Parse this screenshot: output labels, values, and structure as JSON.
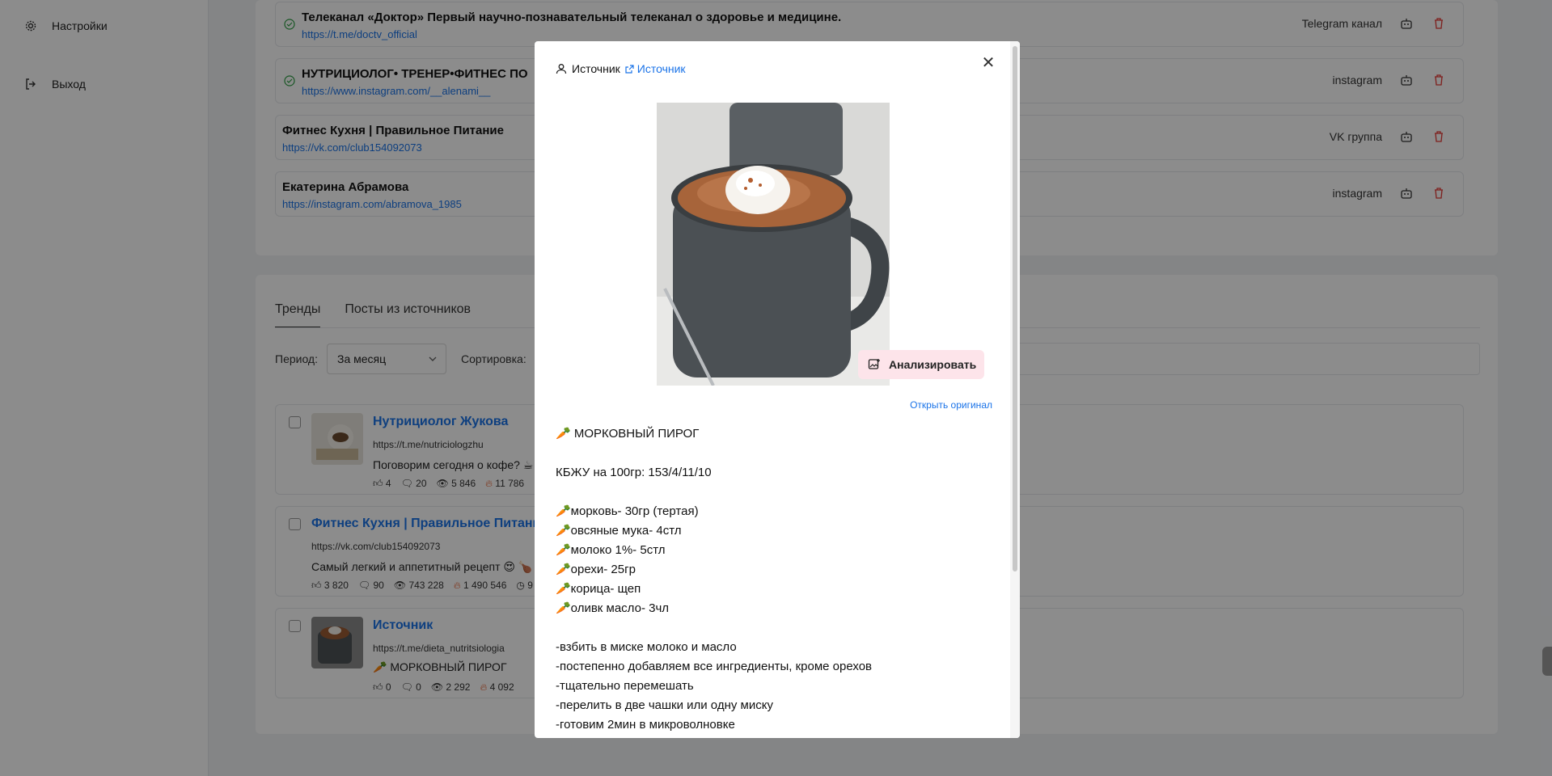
{
  "sidebar": {
    "items": [
      {
        "label": "Настройки",
        "icon": "gear-icon"
      },
      {
        "label": "Выход",
        "icon": "logout-icon"
      }
    ]
  },
  "sources": [
    {
      "title": "Телеканал «Доктор» Первый научно-познавательный телеканал о здоровье и медицине.",
      "url": "https://t.me/doctv_official",
      "type": "Telegram канал",
      "checked": true
    },
    {
      "title": "НУТРИЦИОЛОГ• ТРЕНЕР•ФИТНЕС ПО",
      "url": "https://www.instagram.com/__alenami__",
      "type": "instagram",
      "checked": true
    },
    {
      "title": "Фитнес Кухня | Правильное Питание",
      "url": "https://vk.com/club154092073",
      "type": "VK группа",
      "checked": false
    },
    {
      "title": "Екатерина Абрамова",
      "url": "https://instagram.com/abramova_1985",
      "type": "instagram",
      "checked": false
    }
  ],
  "tabs": [
    {
      "label": "Тренды",
      "active": true
    },
    {
      "label": "Посты из источников",
      "active": false
    }
  ],
  "filters": {
    "period_label": "Период:",
    "period_value": "За месяц",
    "sort_label": "Сортировка:"
  },
  "posts": [
    {
      "title": "Нутрициолог Жукова",
      "url": "https://t.me/nutriciologzhu",
      "text": "Поговорим сегодня о кофе? ☕",
      "likes": "4",
      "comments": "20",
      "views": "5 846",
      "reach": "11 786"
    },
    {
      "title": "Фитнес Кухня | Правильное Питание",
      "url": "https://vk.com/club154092073",
      "text": "Самый легкий и аппетитный рецепт 😍 🍗",
      "likes": "3 820",
      "comments": "90",
      "views": "743 228",
      "reach": "1 490 546",
      "extra": "9"
    },
    {
      "title": "Источник",
      "url": "https://t.me/dieta_nutritsiologia",
      "text": "🥕 МОРКОВНЫЙ ПИРОГ",
      "likes": "0",
      "comments": "0",
      "views": "2 292",
      "reach": "4 092"
    }
  ],
  "modal": {
    "source_label": "Источник",
    "source_link": "Источник",
    "analyze_label": "Анализировать",
    "open_original": "Открыть оригинал",
    "body": "🥕 МОРКОВНЫЙ ПИРОГ\n\nКБЖУ на 100гр: 153/4/11/10\n\n🥕морковь- 30гр (тертая)\n🥕овсяные мука- 4стл\n🥕молоко 1%- 5стл\n🥕орехи- 25гр\n🥕корица- щеп\n🥕оливк масло- 3чл\n\n-взбить в миске молоко и масло\n-постепенно добавляем все ингредиенты, кроме орехов\n-тщательно перемешать\n-перелить в две чашки или одну миску\n-готовим 2мин в микроволновке"
  },
  "colors": {
    "accent": "#1a73e8",
    "danger": "#e53935",
    "analyze_bg": "#fde4ea"
  }
}
